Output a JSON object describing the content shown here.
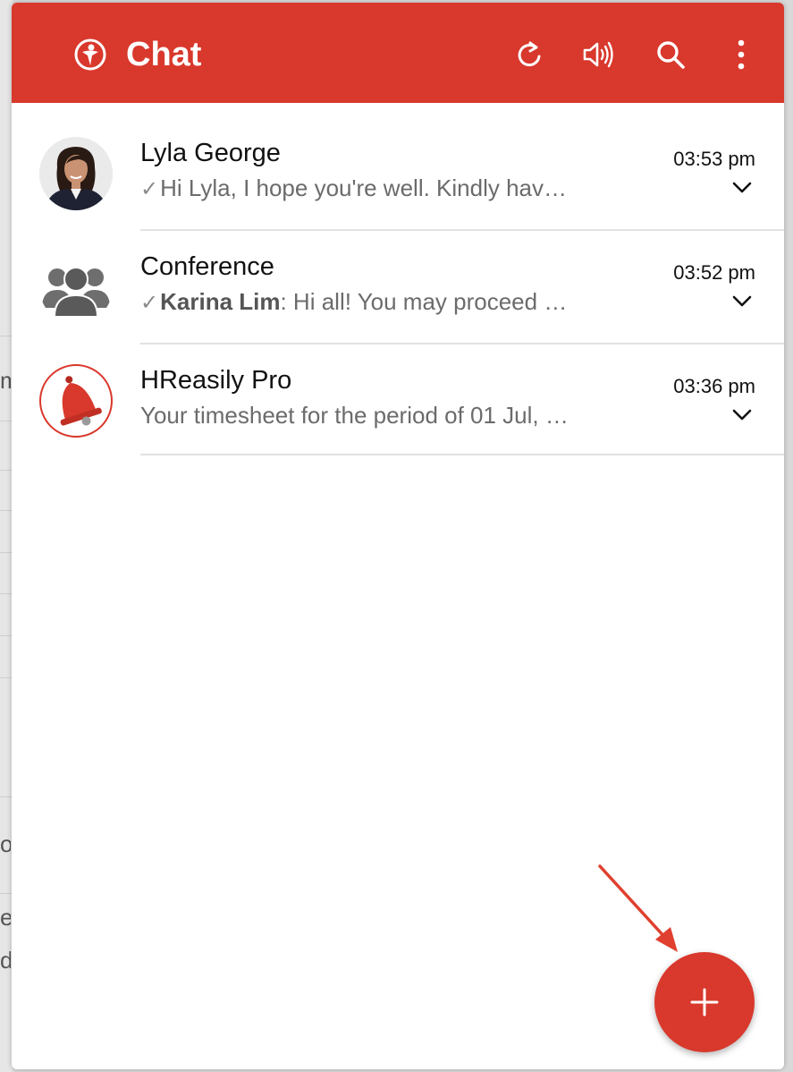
{
  "header": {
    "title": "Chat",
    "color": "#d9382c"
  },
  "icons": {
    "logo": "app-logo-icon",
    "refresh": "refresh-icon",
    "sound": "speaker-icon",
    "search": "search-icon",
    "menu": "more-vertical-icon",
    "new_chat": "plus-icon"
  },
  "conversations": [
    {
      "name": "Lyla George",
      "check": "✓",
      "sender": "",
      "preview": "Hi Lyla, I hope you're well. Kindly hav…",
      "time": "03:53 pm",
      "avatar": "person-photo"
    },
    {
      "name": "Conference",
      "check": "✓",
      "sender": "Karina Lim",
      "preview": ": Hi all! You may proceed …",
      "time": "03:52 pm",
      "avatar": "group-icon"
    },
    {
      "name": "HReasily Pro",
      "check": "",
      "sender": "",
      "preview": "Your timesheet for the period of 01 Jul, …",
      "time": "03:36 pm",
      "avatar": "bell-icon"
    }
  ],
  "background_fragments": [
    "m",
    "or",
    "er",
    "d"
  ]
}
